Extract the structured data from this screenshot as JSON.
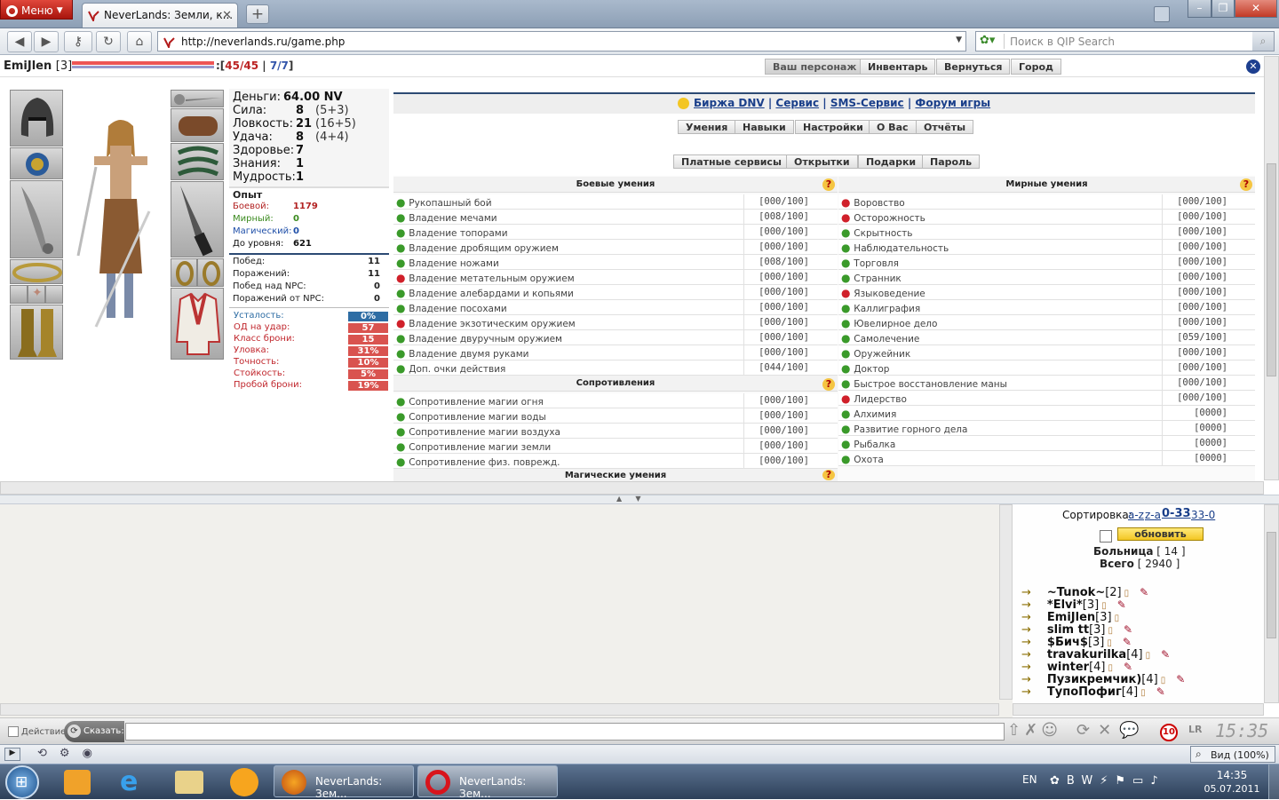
{
  "browser": {
    "menu_label": "Меню",
    "tab_title": "NeverLands: Земли, к...",
    "url": "http://neverlands.ru/game.php",
    "search_placeholder": "Поиск в QIP Search"
  },
  "gamebar": {
    "player": "EmiJlen",
    "level": "[3]",
    "hp": "45/45",
    "mana": "7/7",
    "buttons": [
      "Ваш персонаж",
      "Инвентарь",
      "Вернуться",
      "Город"
    ]
  },
  "character": {
    "stats": [
      {
        "label": "Деньги:",
        "value": "64.00 NV",
        "extra": ""
      },
      {
        "label": "Сила:",
        "value": "8",
        "extra": "(5+3)"
      },
      {
        "label": "Ловкость:",
        "value": "21",
        "extra": "(16+5)"
      },
      {
        "label": "Удача:",
        "value": "8",
        "extra": "(4+4)"
      },
      {
        "label": "Здоровье:",
        "value": "7",
        "extra": ""
      },
      {
        "label": "Знания:",
        "value": "1",
        "extra": ""
      },
      {
        "label": "Мудрость:",
        "value": "1",
        "extra": ""
      }
    ],
    "exp_title": "Опыт",
    "exp": [
      {
        "label": "Боевой:",
        "value": "1179",
        "color": "#b22222"
      },
      {
        "label": "Мирный:",
        "value": "0",
        "color": "#3a8a1e"
      },
      {
        "label": "Магический:",
        "value": "0",
        "color": "#1f4fa8"
      },
      {
        "label": "До уровня:",
        "value": "621",
        "color": "#111111"
      }
    ],
    "battles": [
      {
        "label": "Побед:",
        "value": "11"
      },
      {
        "label": "Поражений:",
        "value": "11"
      },
      {
        "label": "Побед над NPC:",
        "value": "0"
      },
      {
        "label": "Поражений от NPC:",
        "value": "0"
      }
    ],
    "mods": [
      {
        "label": "Усталость:",
        "value": "0%",
        "color": "#2e6da4"
      },
      {
        "label": "ОД на удар:",
        "value": "57",
        "color": "#d9534f"
      },
      {
        "label": "Класс брони:",
        "value": "15",
        "color": "#d9534f"
      },
      {
        "label": "Уловка:",
        "value": "31%",
        "color": "#d9534f"
      },
      {
        "label": "Точность:",
        "value": "10%",
        "color": "#d9534f"
      },
      {
        "label": "Стойкость:",
        "value": "5%",
        "color": "#d9534f"
      },
      {
        "label": "Пробой брони:",
        "value": "19%",
        "color": "#d9534f"
      }
    ]
  },
  "skills": {
    "links": [
      "Биржа DNV",
      "Сервис",
      "SMS-Сервис",
      "Форум игры"
    ],
    "tabs1": [
      "Умения",
      "Навыки",
      "Настройки",
      "О Вас",
      "Отчёты"
    ],
    "tabs2": [
      "Платные сервисы",
      "Открытки",
      "Подарки",
      "Пароль"
    ],
    "combat_title": "Боевые умения",
    "peace_title": "Мирные умения",
    "resist_title": "Сопротивления",
    "magic_title": "Магические умения",
    "combat": [
      {
        "name": "Рукопашный бой",
        "value": "[000/100]",
        "dot": "#3a9a2a"
      },
      {
        "name": "Владение мечами",
        "value": "[008/100]",
        "dot": "#3a9a2a"
      },
      {
        "name": "Владение топорами",
        "value": "[000/100]",
        "dot": "#3a9a2a"
      },
      {
        "name": "Владение дробящим оружием",
        "value": "[000/100]",
        "dot": "#3a9a2a"
      },
      {
        "name": "Владение ножами",
        "value": "[008/100]",
        "dot": "#3a9a2a"
      },
      {
        "name": "Владение метательным оружием",
        "value": "[000/100]",
        "dot": "#d0202a"
      },
      {
        "name": "Владение алебардами и копьями",
        "value": "[000/100]",
        "dot": "#3a9a2a"
      },
      {
        "name": "Владение посохами",
        "value": "[000/100]",
        "dot": "#3a9a2a"
      },
      {
        "name": "Владение экзотическим оружием",
        "value": "[000/100]",
        "dot": "#d0202a"
      },
      {
        "name": "Владение двуручным оружием",
        "value": "[000/100]",
        "dot": "#3a9a2a"
      },
      {
        "name": "Владение двумя руками",
        "value": "[000/100]",
        "dot": "#3a9a2a"
      },
      {
        "name": "Доп. очки действия",
        "value": "[044/100]",
        "dot": "#3a9a2a"
      }
    ],
    "resist": [
      {
        "name": "Сопротивление магии огня",
        "value": "[000/100]",
        "dot": "#3a9a2a"
      },
      {
        "name": "Сопротивление магии воды",
        "value": "[000/100]",
        "dot": "#3a9a2a"
      },
      {
        "name": "Сопротивление магии воздуха",
        "value": "[000/100]",
        "dot": "#3a9a2a"
      },
      {
        "name": "Сопротивление магии земли",
        "value": "[000/100]",
        "dot": "#3a9a2a"
      },
      {
        "name": "Сопротивление физ. поврежд.",
        "value": "[000/100]",
        "dot": "#3a9a2a"
      }
    ],
    "peace": [
      {
        "name": "Воровство",
        "value": "[000/100]",
        "dot": "#d0202a"
      },
      {
        "name": "Осторожность",
        "value": "[000/100]",
        "dot": "#d0202a"
      },
      {
        "name": "Скрытность",
        "value": "[000/100]",
        "dot": "#3a9a2a"
      },
      {
        "name": "Наблюдательность",
        "value": "[000/100]",
        "dot": "#3a9a2a"
      },
      {
        "name": "Торговля",
        "value": "[000/100]",
        "dot": "#3a9a2a"
      },
      {
        "name": "Странник",
        "value": "[000/100]",
        "dot": "#3a9a2a"
      },
      {
        "name": "Языковедение",
        "value": "[000/100]",
        "dot": "#d0202a"
      },
      {
        "name": "Каллиграфия",
        "value": "[000/100]",
        "dot": "#3a9a2a"
      },
      {
        "name": "Ювелирное дело",
        "value": "[000/100]",
        "dot": "#3a9a2a"
      },
      {
        "name": "Самолечение",
        "value": "[059/100]",
        "dot": "#3a9a2a"
      },
      {
        "name": "Оружейник",
        "value": "[000/100]",
        "dot": "#3a9a2a"
      },
      {
        "name": "Доктор",
        "value": "[000/100]",
        "dot": "#3a9a2a"
      },
      {
        "name": "Быстрое восстановление маны",
        "value": "[000/100]",
        "dot": "#3a9a2a"
      },
      {
        "name": "Лидерство",
        "value": "[000/100]",
        "dot": "#d0202a"
      },
      {
        "name": "Алхимия",
        "value": "[0000]",
        "dot": "#3a9a2a"
      },
      {
        "name": "Развитие горного дела",
        "value": "[0000]",
        "dot": "#3a9a2a"
      },
      {
        "name": "Рыбалка",
        "value": "[0000]",
        "dot": "#3a9a2a"
      },
      {
        "name": "Охота",
        "value": "[0000]",
        "dot": "#3a9a2a"
      }
    ]
  },
  "online": {
    "sort_label": "Сортировка:",
    "sort_options": [
      "a-z",
      "z-a",
      "0-33",
      "33-0"
    ],
    "refresh": "обновить",
    "location": "Больница",
    "location_count": "[ 14 ]",
    "total_label": "Всего",
    "total_count": "[ 2940 ]",
    "users": [
      {
        "name": "~Tunok~",
        "level": "[2]"
      },
      {
        "name": "*Elvi*",
        "level": "[3]"
      },
      {
        "name": "EmiJlen",
        "level": "[3]"
      },
      {
        "name": "slim tt",
        "level": "[3]"
      },
      {
        "name": "$Бич$",
        "level": "[3]"
      },
      {
        "name": "travakurilka",
        "level": "[4]"
      },
      {
        "name": "winter",
        "level": "[4]"
      },
      {
        "name": "Пузикремчик)",
        "level": "[4]"
      },
      {
        "name": "ТупоПофиг",
        "level": "[4]"
      }
    ]
  },
  "inputbar": {
    "action": "Действие",
    "say": "Сказать:",
    "badge": "10",
    "clock": "15:35"
  },
  "statusbar": {
    "zoom": "Вид (100%)"
  },
  "taskbar": {
    "tasks": [
      "NeverLands: Зем...",
      "NeverLands: Зем..."
    ],
    "lang": "EN",
    "time": "14:35",
    "date": "05.07.2011"
  }
}
